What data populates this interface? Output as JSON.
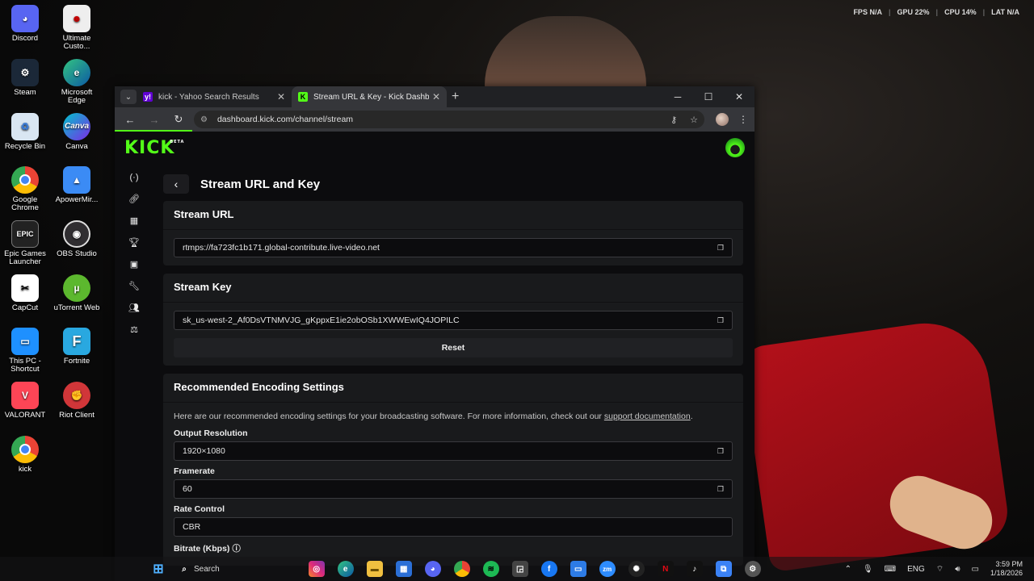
{
  "hud": {
    "fps_label": "FPS",
    "fps": "N/A",
    "gpu_label": "GPU",
    "gpu": "22%",
    "cpu_label": "CPU",
    "cpu": "14%",
    "lat_label": "LAT",
    "lat": "N/A"
  },
  "desktop": {
    "icons": [
      {
        "label": "Discord"
      },
      {
        "label": "Ultimate Custo..."
      },
      {
        "label": "Steam"
      },
      {
        "label": "Microsoft Edge"
      },
      {
        "label": "Recycle Bin"
      },
      {
        "label": "Canva"
      },
      {
        "label": "Google Chrome"
      },
      {
        "label": "ApowerMir..."
      },
      {
        "label": "Epic Games Launcher"
      },
      {
        "label": "OBS Studio"
      },
      {
        "label": "CapCut"
      },
      {
        "label": "uTorrent Web"
      },
      {
        "label": "This PC - Shortcut"
      },
      {
        "label": "Fortnite"
      },
      {
        "label": "VALORANT"
      },
      {
        "label": "Riot Client"
      },
      {
        "label": "kick"
      }
    ]
  },
  "browser": {
    "tabs": [
      {
        "title": "kick - Yahoo Search Results",
        "favicon": "y!"
      },
      {
        "title": "Stream URL & Key - Kick Dashb",
        "favicon": "K"
      }
    ],
    "url": "dashboard.kick.com/channel/stream"
  },
  "kick": {
    "logo": "KICK",
    "logo_badge": "BETA",
    "page_title": "Stream URL and Key",
    "stream_url_title": "Stream URL",
    "stream_url": "rtmps://fa723fc1b171.global-contribute.live-video.net",
    "stream_key_title": "Stream Key",
    "stream_key": "sk_us-west-2_Af0DsVTNMVJG_gKppxE1ie2obOSb1XWWEwIQ4JOPILC",
    "reset_label": "Reset",
    "encoding_title": "Recommended Encoding Settings",
    "encoding_desc": "Here are our recommended encoding settings for your broadcasting software. For more information, check out our",
    "support_link": "support documentation",
    "resolution_label": "Output Resolution",
    "resolution": "1920×1080",
    "framerate_label": "Framerate",
    "framerate": "60",
    "rate_control_label": "Rate Control",
    "rate_control": "CBR",
    "bitrate_label": "Bitrate (Kbps)"
  },
  "taskbar": {
    "search_placeholder": "Search",
    "lang": "ENG",
    "time": "3:59 PM",
    "date": "1/18/2026"
  }
}
